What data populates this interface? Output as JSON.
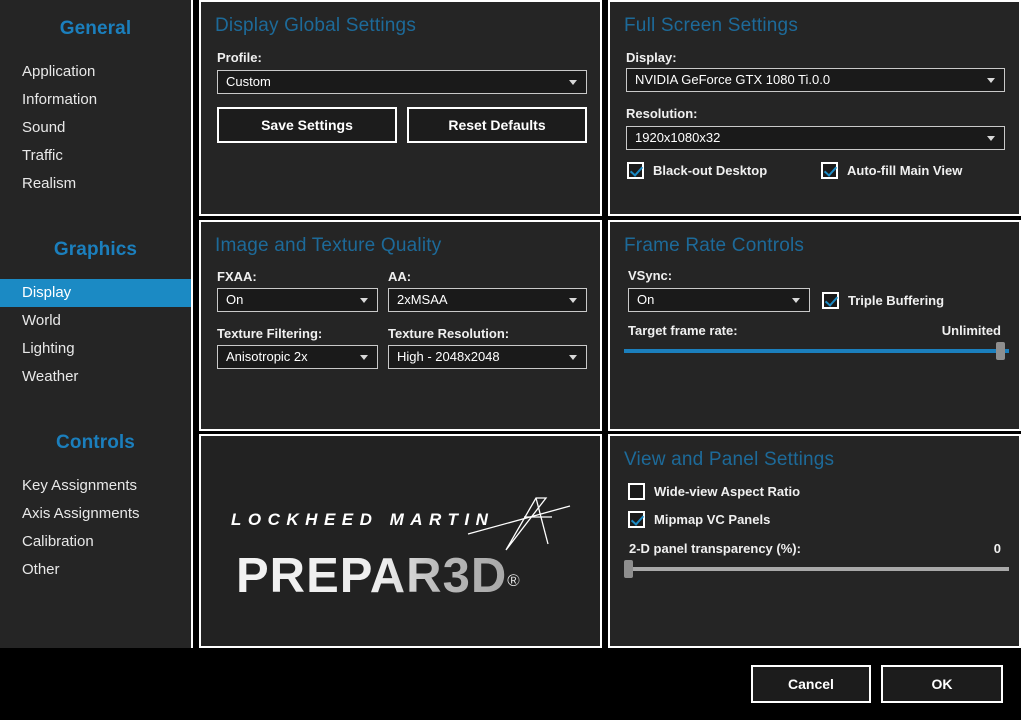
{
  "sidebar": {
    "groups": [
      {
        "title": "General",
        "items": [
          {
            "label": "Application",
            "active": false
          },
          {
            "label": "Information",
            "active": false
          },
          {
            "label": "Sound",
            "active": false
          },
          {
            "label": "Traffic",
            "active": false
          },
          {
            "label": "Realism",
            "active": false
          }
        ]
      },
      {
        "title": "Graphics",
        "items": [
          {
            "label": "Display",
            "active": true
          },
          {
            "label": "World",
            "active": false
          },
          {
            "label": "Lighting",
            "active": false
          },
          {
            "label": "Weather",
            "active": false
          }
        ]
      },
      {
        "title": "Controls",
        "items": [
          {
            "label": "Key Assignments",
            "active": false
          },
          {
            "label": "Axis Assignments",
            "active": false
          },
          {
            "label": "Calibration",
            "active": false
          },
          {
            "label": "Other",
            "active": false
          }
        ]
      }
    ]
  },
  "display_global_settings": {
    "title": "Display Global Settings",
    "profile_label": "Profile:",
    "profile_value": "Custom",
    "save_label": "Save Settings",
    "reset_label": "Reset Defaults"
  },
  "full_screen_settings": {
    "title": "Full Screen Settings",
    "display_label": "Display:",
    "display_value": "NVIDIA GeForce GTX 1080 Ti.0.0",
    "resolution_label": "Resolution:",
    "resolution_value": "1920x1080x32",
    "blackout_label": "Black-out Desktop",
    "blackout_checked": true,
    "autofill_label": "Auto-fill Main View",
    "autofill_checked": true
  },
  "image_texture_quality": {
    "title": "Image and Texture Quality",
    "fxaa_label": "FXAA:",
    "fxaa_value": "On",
    "aa_label": "AA:",
    "aa_value": "2xMSAA",
    "texture_filtering_label": "Texture Filtering:",
    "texture_filtering_value": "Anisotropic 2x",
    "texture_resolution_label": "Texture Resolution:",
    "texture_resolution_value": "High - 2048x2048"
  },
  "frame_rate_controls": {
    "title": "Frame Rate Controls",
    "vsync_label": "VSync:",
    "vsync_value": "On",
    "triple_buffering_label": "Triple Buffering",
    "triple_buffering_checked": true,
    "target_frame_rate_label": "Target frame rate:",
    "target_frame_rate_value": "Unlimited",
    "target_frame_rate_percent": 100
  },
  "view_panel_settings": {
    "title": "View and Panel Settings",
    "wideview_label": "Wide-view Aspect Ratio",
    "wideview_checked": false,
    "mipmap_label": "Mipmap VC Panels",
    "mipmap_checked": true,
    "transparency_label": "2-D panel transparency (%):",
    "transparency_value": "0",
    "transparency_percent": 0
  },
  "branding": {
    "company": "LOCKHEED MARTIN",
    "product": "PREPAR3D",
    "registered": "®"
  },
  "footer": {
    "cancel_label": "Cancel",
    "ok_label": "OK"
  },
  "colors": {
    "accent_blue": "#1b8ac4",
    "title_blue": "#1d6a99",
    "panel_bg": "#252525",
    "window_bg": "#000000",
    "slider_fill": "#1b7fbd",
    "slider_track": "#a9a9a9"
  }
}
